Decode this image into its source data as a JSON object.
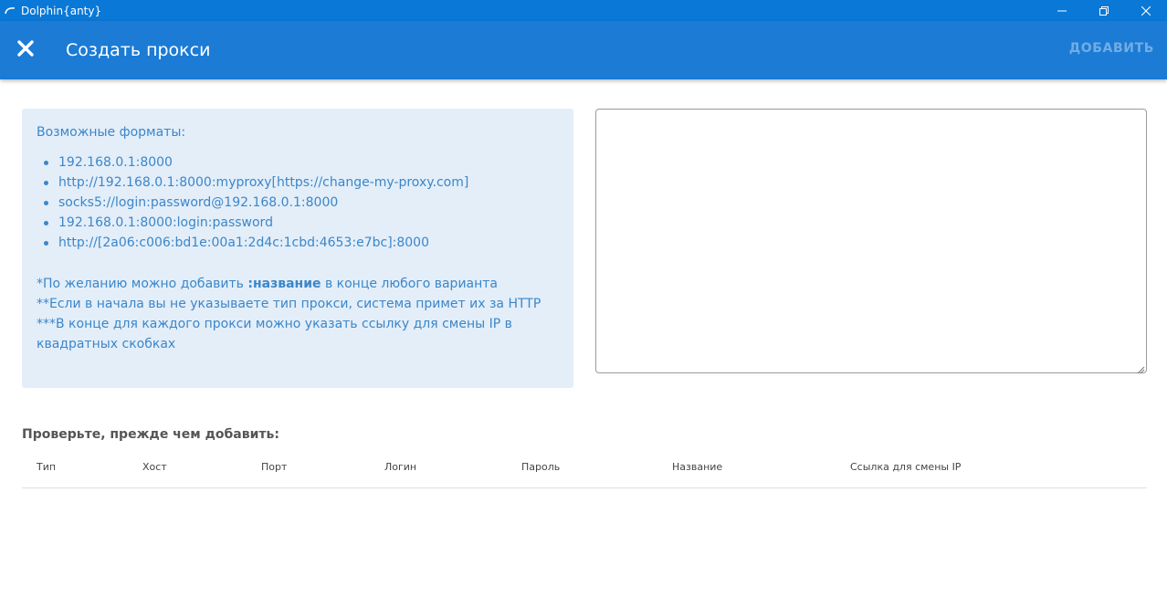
{
  "window": {
    "title": "Dolphin{anty}",
    "controls": {
      "minimize_icon": "minimize-icon",
      "restore_icon": "restore-icon",
      "close_icon": "close-icon"
    }
  },
  "appbar": {
    "title": "Создать прокси",
    "add_label": "ДОБАВИТЬ",
    "close_icon": "close-icon",
    "color": "#1b7bd5"
  },
  "info": {
    "heading": "Возможные форматы:",
    "formats": [
      "192.168.0.1:8000",
      "http://192.168.0.1:8000:myproxy[https://change-my-proxy.com]",
      "socks5://login:password@192.168.0.1:8000",
      "192.168.0.1:8000:login:password",
      "http://[2a06:c006:bd1e:00a1:2d4c:1cbd:4653:e7bc]:8000"
    ],
    "note1_prefix": "*По желанию можно добавить ",
    "note1_bold": ":название",
    "note1_suffix": " в конце любого варианта",
    "note2": "**Если в начала вы не указываете тип прокси, система примет их за HTTP",
    "note3_line1": "***В конце для каждого прокси можно указать ссылку для смены IP в",
    "note3_line2": "квадратных скобках",
    "background": "#e3eef9",
    "text_color": "#3c86c9"
  },
  "input": {
    "value": "",
    "placeholder": ""
  },
  "check": {
    "title": "Проверьте, прежде чем добавить:",
    "columns": [
      "Тип",
      "Хост",
      "Порт",
      "Логин",
      "Пароль",
      "Название",
      "Ссылка для смены IP"
    ],
    "rows": []
  }
}
